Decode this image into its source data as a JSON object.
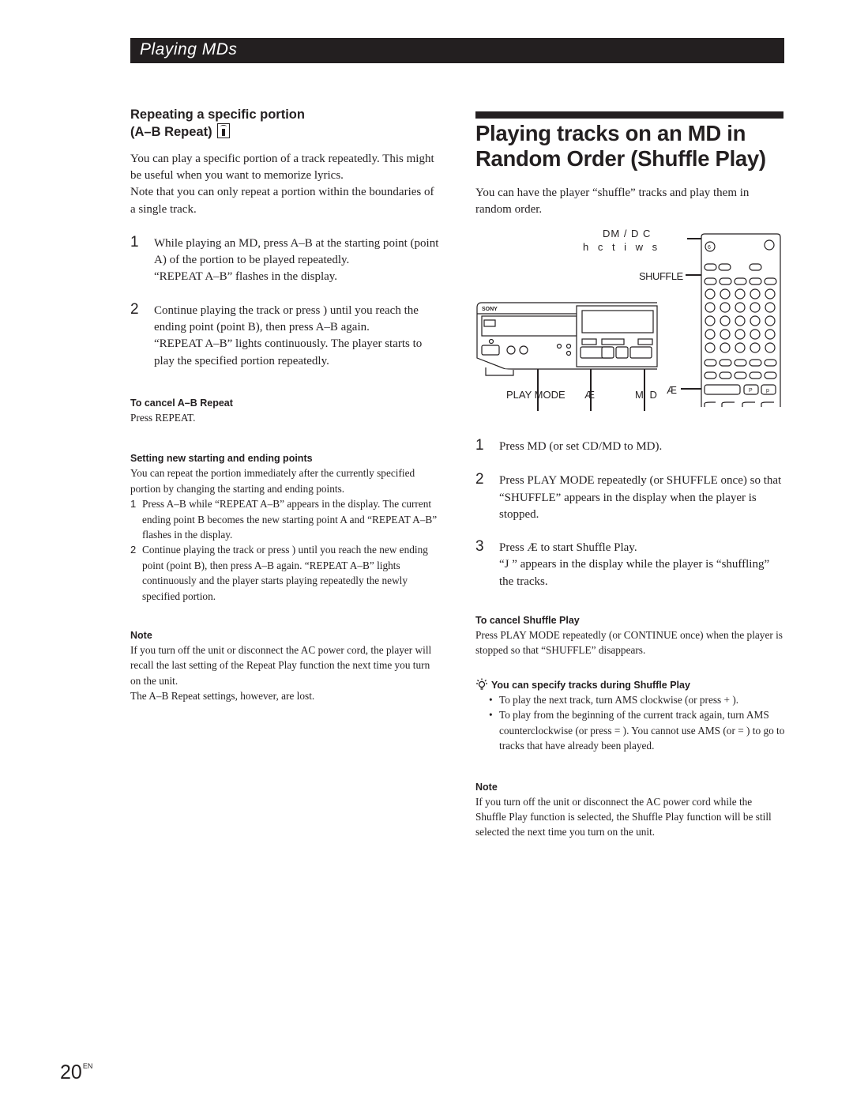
{
  "header": {
    "section_title": "Playing MDs"
  },
  "left": {
    "heading_line1": "Repeating a specific portion",
    "heading_line2": "(A–B Repeat)",
    "heading_icon": "remote-control-icon",
    "intro": [
      "You can play a specific portion of a track repeatedly. This might be useful when you want to memorize lyrics.",
      "Note that you can only repeat a portion within the boundaries of a single track."
    ],
    "steps": [
      {
        "num": "1",
        "text": "While playing an MD, press A–B at the starting point (point A) of the portion to be played repeatedly.",
        "result": "“REPEAT A–B” flashes in the display."
      },
      {
        "num": "2",
        "text": "Continue playing the track or press )      until you reach the ending point (point B), then press A–B again.",
        "result": "“REPEAT A–B” lights continuously.  The player starts to play the specified portion repeatedly."
      }
    ],
    "cancel": {
      "title": "To cancel A–B Repeat",
      "text": "Press REPEAT."
    },
    "setting": {
      "title": "Setting new starting and ending points",
      "text": "You can repeat the portion immediately after the currently specified portion by changing the starting and ending points.",
      "steps": [
        {
          "num": "1",
          "text": "Press A–B while “REPEAT A–B” appears in the display. The current ending point B becomes the new starting point A and “REPEAT A–B” flashes in the display."
        },
        {
          "num": "2",
          "text": "Continue playing the track or press )      until you reach the new ending point (point B), then press A–B again. “REPEAT A–B” lights continuously and the player starts playing repeatedly the newly specified portion."
        }
      ]
    },
    "note": {
      "title": "Note",
      "lines": [
        "If you turn off the unit or disconnect the AC power cord, the player will recall the last setting of the Repeat Play function the next time you turn on the unit.",
        "The A–B Repeat settings, however, are lost."
      ]
    }
  },
  "right": {
    "title_line1": "Playing tracks on an MD in",
    "title_line2": "Random Order (Shuffle Play)",
    "intro": "You can have the player “shuffle” tracks and play them in random order.",
    "diagram": {
      "label_cdmd_1": "DM / D C",
      "label_cdmd_2": "h c t i w s",
      "label_shuffle": "SHUFFLE",
      "label_play_mode": "PLAY MODE",
      "label_play_symbol": "Æ",
      "label_md": "M D",
      "label_remote_play": "Æ",
      "brand": "SONY",
      "remote_top_button": "6",
      "remote_p1": "P",
      "remote_p2": "p"
    },
    "steps": [
      {
        "num": "1",
        "text": "Press MD (or set CD/MD to MD).",
        "result": ""
      },
      {
        "num": "2",
        "text": "Press PLAY MODE repeatedly (or SHUFFLE once) so that “SHUFFLE” appears in the display when the player is stopped.",
        "result": ""
      },
      {
        "num": "3",
        "text": "Press Æ   to start Shuffle Play.",
        "result": "“J  ” appears in the display while the player is “shuffling” the tracks."
      }
    ],
    "cancel": {
      "title": "To cancel Shuffle Play",
      "text": "Press PLAY MODE repeatedly (or CONTINUE once) when the player is stopped so that “SHUFFLE” disappears."
    },
    "tip": {
      "icon": "lightbulb-icon",
      "title": "You can specify tracks during Shuffle Play",
      "bullets": [
        "To play the next track, turn AMS clockwise (or press +     ).",
        "To play from the beginning of the current track again, turn AMS counterclockwise (or press =     ).  You cannot use AMS (or =     ) to go to tracks that have already been played."
      ]
    },
    "note": {
      "title": "Note",
      "text": "If you turn off the unit or disconnect the AC power cord while the Shuffle Play function is selected, the Shuffle Play function will be still selected the next time you turn on the unit."
    }
  },
  "footer": {
    "page_number": "20",
    "page_suffix": "EN"
  }
}
